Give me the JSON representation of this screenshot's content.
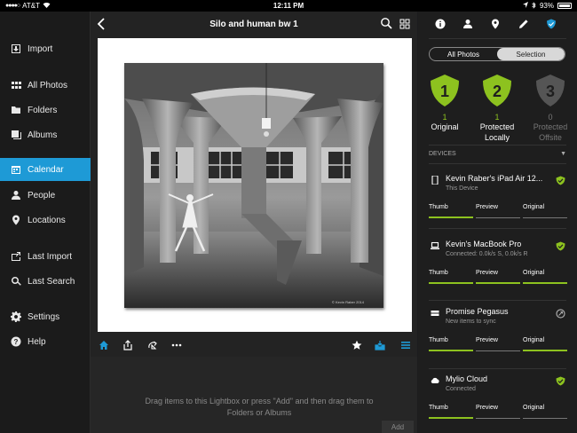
{
  "statusbar": {
    "carrier": "AT&T",
    "signal": "●●●●○",
    "time": "12:11 PM",
    "battery": "93%"
  },
  "sidebar": {
    "items": [
      {
        "label": "Import",
        "icon": "import-icon"
      },
      {
        "label": "All Photos",
        "icon": "grid-icon"
      },
      {
        "label": "Folders",
        "icon": "folder-icon"
      },
      {
        "label": "Albums",
        "icon": "albums-icon"
      },
      {
        "label": "Calendar",
        "icon": "calendar-icon"
      },
      {
        "label": "People",
        "icon": "person-icon"
      },
      {
        "label": "Locations",
        "icon": "location-pin-icon"
      },
      {
        "label": "Last Import",
        "icon": "last-import-icon"
      },
      {
        "label": "Last Search",
        "icon": "search-icon"
      },
      {
        "label": "Settings",
        "icon": "gear-icon"
      },
      {
        "label": "Help",
        "icon": "help-icon"
      }
    ],
    "active": "Calendar"
  },
  "main": {
    "title": "Silo and human bw 1",
    "photo_caption": "© Kevin Raber 2014",
    "lightbox_text": "Drag items to this Lightbox or press \"Add\" and then drag them to Folders or Albums",
    "add_label": "Add"
  },
  "panel": {
    "segments": {
      "left": "All Photos",
      "right": "Selection",
      "selected": "Selection"
    },
    "shields": [
      {
        "digit": "1",
        "count": "1",
        "label": "Original",
        "color": "#8dc21f"
      },
      {
        "digit": "2",
        "count": "1",
        "label": "Protected Locally",
        "color": "#8dc21f"
      },
      {
        "digit": "3",
        "count": "0",
        "label": "Protected Offsite",
        "color": "#555555"
      }
    ],
    "devices_header": "DEVICES",
    "devices": [
      {
        "name": "Kevin Raber's iPad Air 12...",
        "sub": "This Device",
        "icon": "tablet-icon",
        "status": "synced",
        "tabs": [
          "Thumb",
          "Preview",
          "Original"
        ]
      },
      {
        "name": "Kevin's MacBook Pro",
        "sub": "Connected: 0.0k/s S, 0.0k/s R",
        "icon": "laptop-icon",
        "status": "synced",
        "tabs": [
          "Thumb",
          "Preview",
          "Original"
        ]
      },
      {
        "name": "Promise Pegasus",
        "sub": "New items to sync",
        "icon": "drive-icon",
        "status": "syncing",
        "tabs": [
          "Thumb",
          "Preview",
          "Original"
        ]
      },
      {
        "name": "Mylio Cloud",
        "sub": "Connected",
        "icon": "cloud-icon",
        "status": "synced",
        "tabs": [
          "Thumb",
          "Preview",
          "Original"
        ]
      }
    ]
  },
  "colors": {
    "accent": "#1e9ad6",
    "green": "#8dc21f"
  }
}
